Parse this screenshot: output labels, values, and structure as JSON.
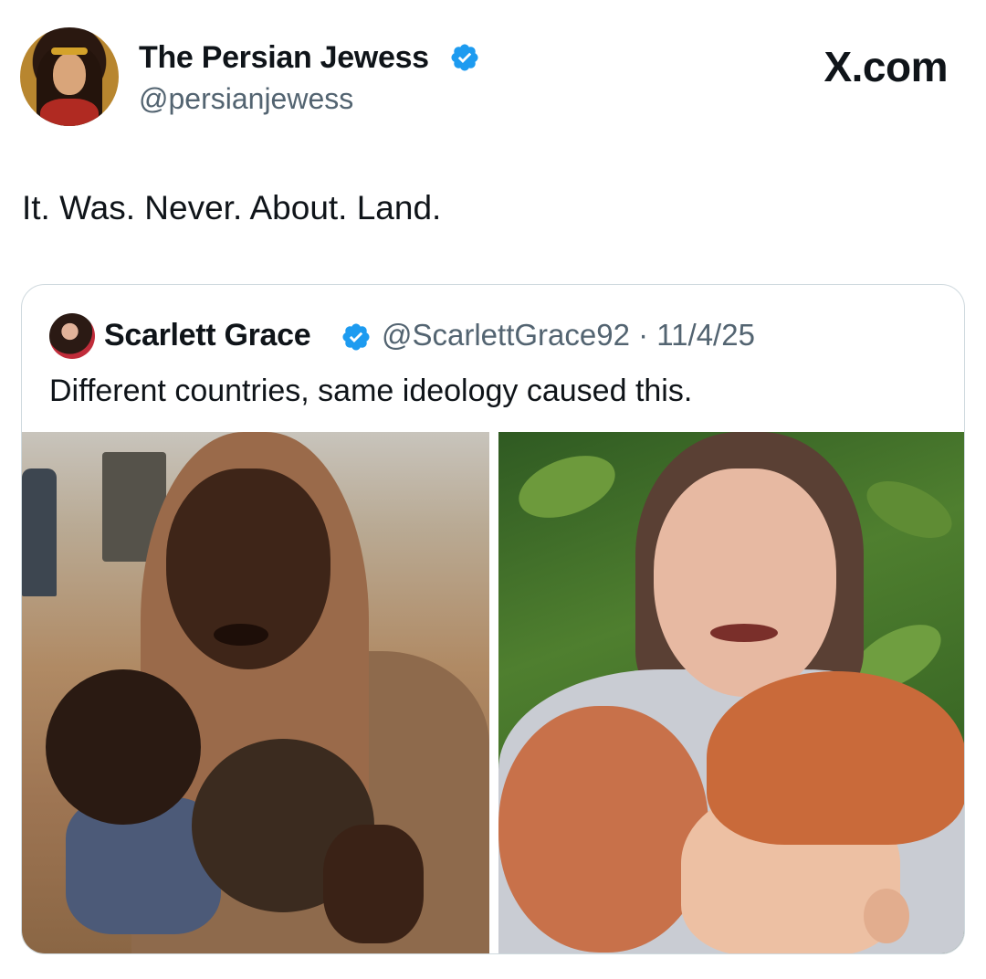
{
  "header": {
    "author_name": "The Persian Jewess",
    "author_handle": "@persianjewess",
    "brand": "X.com",
    "verified_color": "#1d9bf0"
  },
  "tweet": {
    "text": "It. Was. Never. About. Land."
  },
  "quoted_tweet": {
    "author_name": "Scarlett Grace",
    "meta": "@ScarlettGrace92 · 11/4/25",
    "text": "Different countries, same ideology caused this."
  }
}
